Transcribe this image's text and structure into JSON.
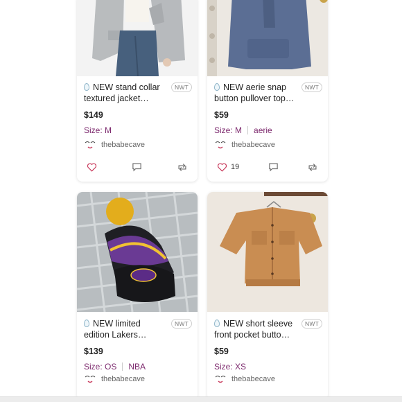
{
  "listings": [
    {
      "title": "NEW stand collar textured jacket coat…",
      "badge": "NWT",
      "price": "$149",
      "size": "Size: M",
      "brand": "",
      "seller": "thebabecave",
      "likes": ""
    },
    {
      "title": "NEW aerie snap button pullover top…",
      "badge": "NWT",
      "price": "$59",
      "size": "Size: M",
      "brand": "aerie",
      "seller": "thebabecave",
      "likes": "19"
    },
    {
      "title": "NEW limited edition Lakers…",
      "badge": "NWT",
      "price": "$139",
      "size": "Size: OS",
      "brand": "NBA",
      "seller": "thebabecave",
      "likes": ""
    },
    {
      "title": "NEW short sleeve front pocket button t…",
      "badge": "NWT",
      "price": "$59",
      "size": "Size: XS",
      "brand": "",
      "seller": "thebabecave",
      "likes": ""
    }
  ],
  "colors": {
    "accent": "#7d2a6e",
    "heart": "#c8385a",
    "icon": "#666666"
  },
  "icons": [
    "like-heart-icon",
    "comment-icon",
    "share-icon",
    "water-drop-icon",
    "seller-avatar-icon"
  ]
}
